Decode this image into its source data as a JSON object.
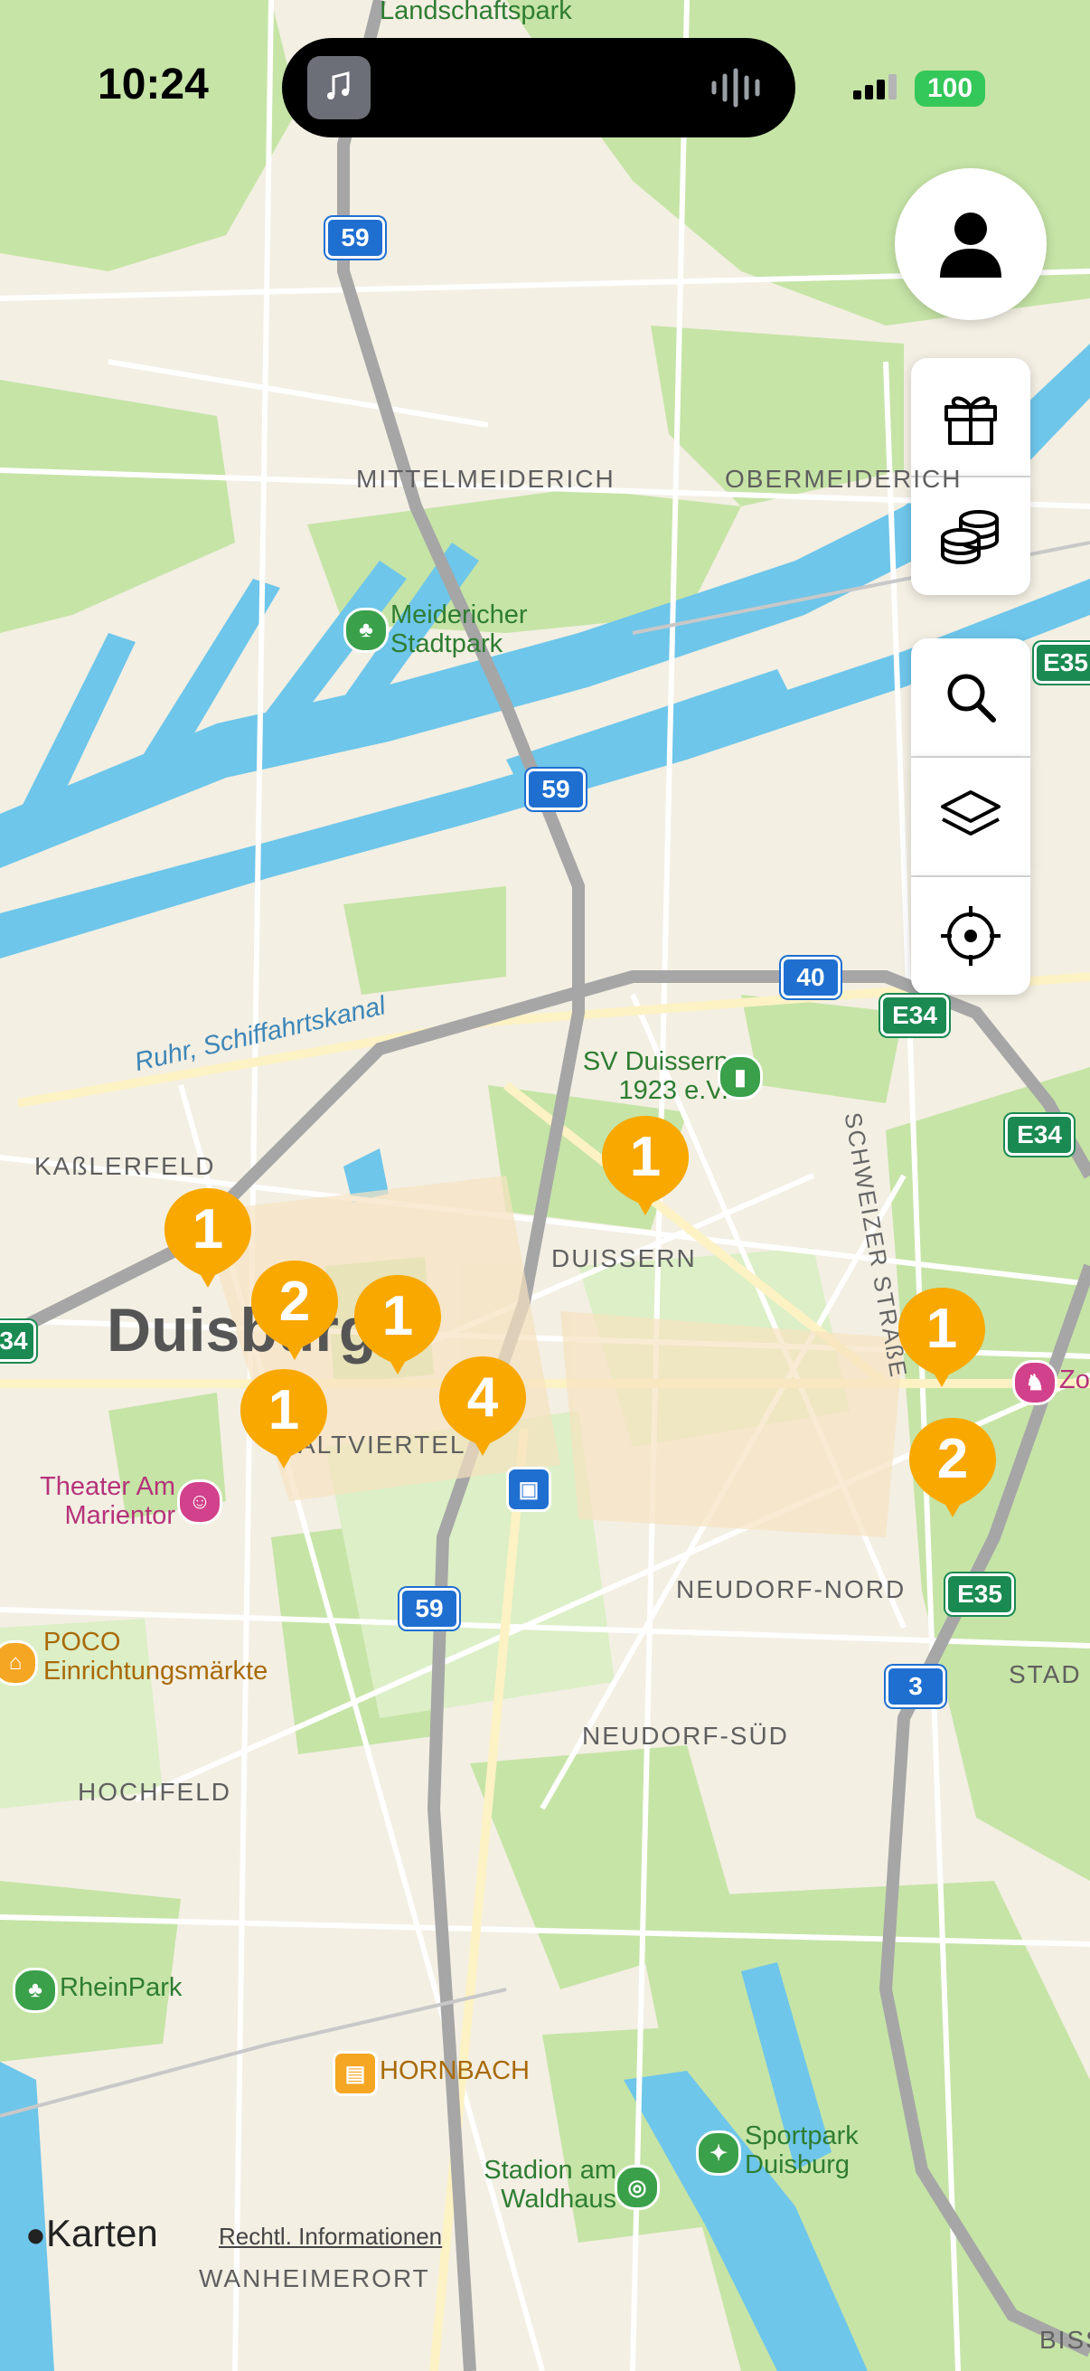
{
  "status_bar": {
    "time": "10:24",
    "battery": "100"
  },
  "map_labels": {
    "top_park": "Landschaftspark",
    "mittelmeiderich": "MITTELMEIDERICH",
    "obermeiderich": "OBERMEIDERICH",
    "meidericher_stadtpark": "Meidericher Stadtpark",
    "canal": "Ruhr, Schiffahrtskanal",
    "sv_duissern": "SV Duissern 1923 e.V.",
    "kasslerfeld": "KAßLERFELD",
    "duissern": "DUISSERN",
    "duisburg": "Duisburg",
    "altstadt": "ALTVIERTEL",
    "theater": "Theater Am Marientor",
    "poco": "POCO Einrichtungsmärkte",
    "neudorf_nord": "NEUDORF-NORD",
    "neudorf_sued": "NEUDORF-SÜD",
    "hochfeld": "HOCHFELD",
    "rheinpark": "RheinPark",
    "hornbach": "HORNBACH",
    "stadion": "Stadion am Waldhaus",
    "sportpark": "Sportpark Duisburg",
    "wanheimerort": "WANHEIMERORT",
    "schweizer_strasse": "SCHWEIZER STRAßE",
    "zoo": "Zo",
    "stad": "STAD",
    "biss": "BISS"
  },
  "highways": [
    "59",
    "59",
    "59",
    "40",
    "3",
    "E35",
    "E34",
    "E34",
    "E35",
    "34"
  ],
  "clusters": [
    "1",
    "2",
    "1",
    "1",
    "4",
    "1",
    "1",
    "2"
  ],
  "footer": {
    "app_name": "Karten",
    "legal": "Rechtl. Informationen"
  },
  "icons": [
    "profile-icon",
    "gift-icon",
    "coins-icon",
    "search-icon",
    "layers-icon",
    "locate-icon"
  ],
  "colors": {
    "cluster": "#f9a800",
    "water": "#6ec6ea",
    "park": "#c6e4a6",
    "land": "#f3efe3",
    "road": "#ffffff",
    "motorway": "#a6a6a6"
  }
}
